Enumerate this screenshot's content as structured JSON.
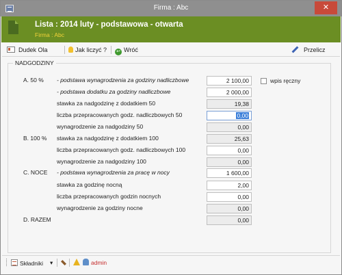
{
  "window": {
    "title": "Firma : Abc",
    "close_glyph": "✕"
  },
  "header": {
    "title": "Lista : 2014 luty - podstawowa - otwarta",
    "subtitle": "Firma : Abc"
  },
  "toolbar": {
    "employee": "Dudek Ola",
    "how_calc": "Jak liczyć ?",
    "back": "Wróć",
    "recalc": "Przelicz",
    "back_glyph": "↩"
  },
  "group": {
    "legend": "NADGODZINY"
  },
  "manual_entry_label": "wpis ręczny",
  "sections": {
    "a": "A. 50 %",
    "b": "B. 100 %",
    "c": "C. NOCE",
    "d": "D. RAZEM"
  },
  "rows": [
    {
      "label": "- podstawa wynagrodzenia za godziny nadliczbowe",
      "value": "2 100,00"
    },
    {
      "label": "- podstawa dodatku za godziny nadliczbowe",
      "value": "2 000,00"
    },
    {
      "label": "stawka za nadgodzinę z dodatkiem 50",
      "value": "19,38"
    },
    {
      "label": "liczba przepracowanych godz. nadliczbowych 50",
      "value": "0,00"
    },
    {
      "label": "wynagrodzenie za nadgodziny 50",
      "value": "0,00"
    },
    {
      "label": "stawka za nadgodzinę z dodatkiem 100",
      "value": "25,63"
    },
    {
      "label": "liczba przepracowanych godz. nadliczbowych 100",
      "value": "0,00"
    },
    {
      "label": "wynagrodzenie za nadgodziny 100",
      "value": "0,00"
    },
    {
      "label": "- podstawa wynagrodzenia za pracę w nocy",
      "value": "1 600,00"
    },
    {
      "label": "stawka za godzinę nocną",
      "value": "2,00"
    },
    {
      "label": "liczba przepracowanych godzin nocnych",
      "value": "0,00"
    },
    {
      "label": "wynagrodzenie za godziny nocne",
      "value": "0,00"
    },
    {
      "label": "",
      "value": "0,00"
    }
  ],
  "statusbar": {
    "components": "Składniki",
    "dropdown_glyph": "▾",
    "user": "admin"
  },
  "icons": [
    "app-icon",
    "close-icon",
    "document-icon",
    "employee-card-icon",
    "lightbulb-icon",
    "back-arrow-icon",
    "pen-icon",
    "list-icon",
    "broom-icon",
    "warning-icon",
    "user-icon"
  ],
  "colors": {
    "header_bg": "#6b8e23",
    "subtitle": "#f2d23a",
    "close_bg": "#c84a3a",
    "selection": "#3b7fd9",
    "admin_text": "#c42b2b"
  }
}
